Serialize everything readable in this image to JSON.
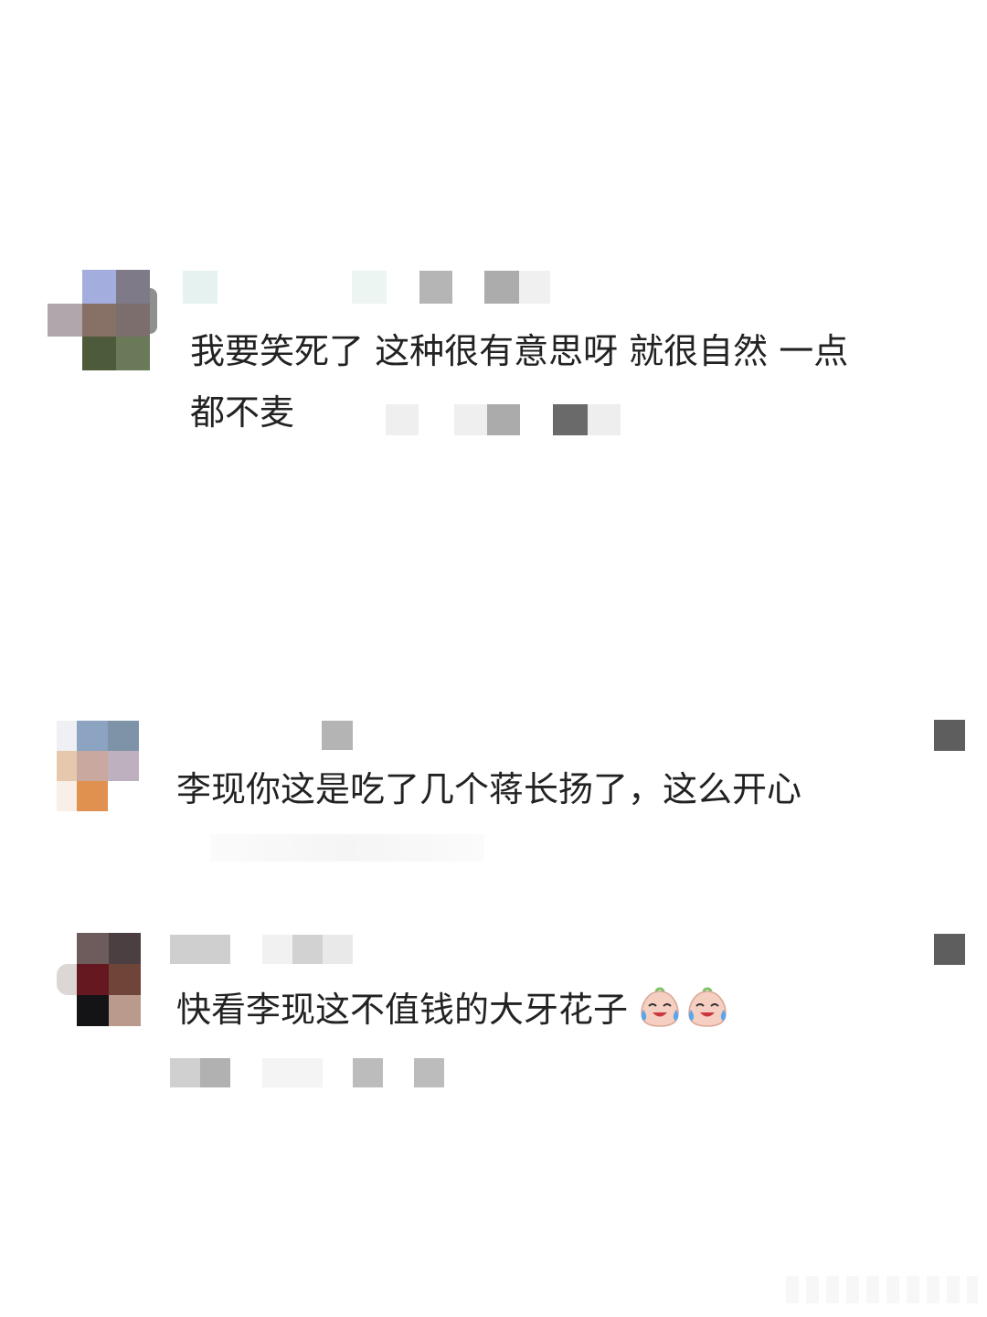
{
  "comments": [
    {
      "text_line1": "我要笑死了 这种很有意思呀 就很自然 一点",
      "text_line2": "都不麦",
      "avatar_icon": "pixelated-avatar-icon"
    },
    {
      "text": "李现你这是吃了几个蒋长扬了，这么开心",
      "avatar_icon": "pixelated-avatar-icon",
      "menu_icon": "pixelated-menu-icon"
    },
    {
      "text": "快看李现这不值钱的大牙花子",
      "emojis": [
        "laugh-cry-emoji",
        "laugh-cry-emoji"
      ],
      "avatar_icon": "pixelated-avatar-icon",
      "menu_icon": "pixelated-menu-icon"
    }
  ],
  "colors": {
    "background": "#ffffff",
    "text": "#222222",
    "mosaic_gray": "#a9a9a9"
  }
}
